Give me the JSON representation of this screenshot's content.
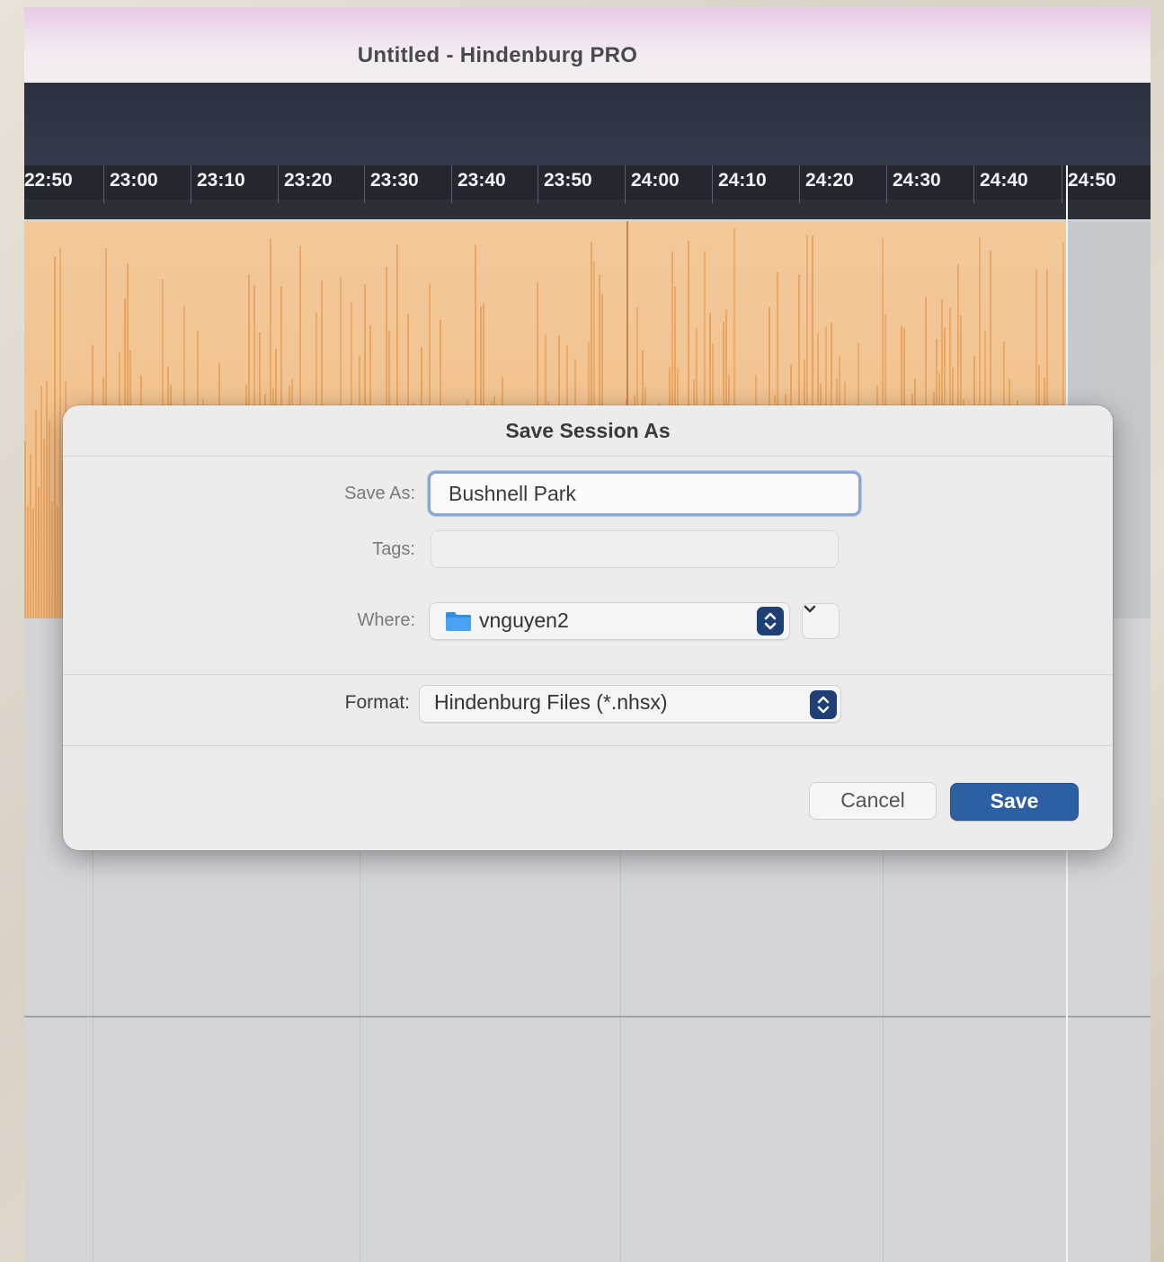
{
  "window": {
    "title": "Untitled - Hindenburg PRO"
  },
  "timeline": {
    "ticks": [
      "22:50",
      "23:00",
      "23:10",
      "23:20",
      "23:30",
      "23:40",
      "23:50",
      "24:00",
      "24:10",
      "24:20",
      "24:30",
      "24:40",
      "24:50"
    ]
  },
  "colors": {
    "waveform": "#e8a35f",
    "accent": "#2d5fa3",
    "titlebar_top": "#e7c8e6"
  },
  "dialog": {
    "title": "Save Session As",
    "save_as_label": "Save As:",
    "save_as_value": "Bushnell Park",
    "tags_label": "Tags:",
    "tags_value": "",
    "where_label": "Where:",
    "where_value": "vnguyen2",
    "where_icon": "folder-icon",
    "format_label": "Format:",
    "format_value": "Hindenburg Files (*.nhsx)",
    "cancel_label": "Cancel",
    "save_label": "Save"
  }
}
